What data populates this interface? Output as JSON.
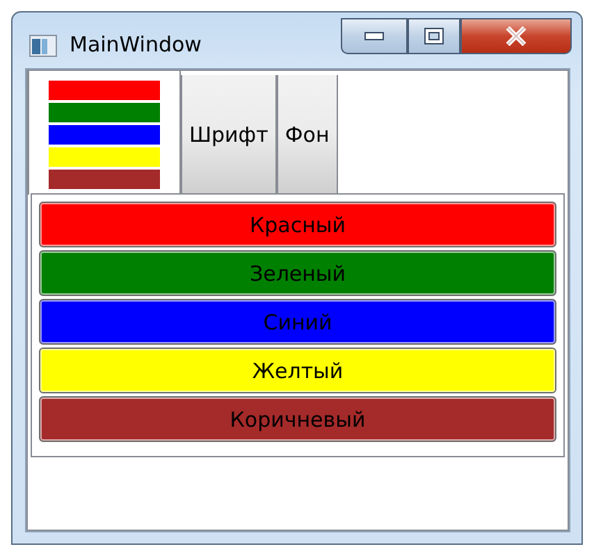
{
  "window": {
    "title": "MainWindow"
  },
  "tabs": [
    {
      "kind": "preview",
      "selected": true
    },
    {
      "kind": "text",
      "label": "Шрифт",
      "selected": false
    },
    {
      "kind": "text",
      "label": "Фон",
      "selected": false
    }
  ],
  "color_buttons": [
    {
      "label": "Красный",
      "color": "#ff0000"
    },
    {
      "label": "Зеленый",
      "color": "#008000"
    },
    {
      "label": "Синий",
      "color": "#0000ff"
    },
    {
      "label": "Желтый",
      "color": "#ffff00"
    },
    {
      "label": "Коричневый",
      "color": "#a52a2a"
    }
  ]
}
